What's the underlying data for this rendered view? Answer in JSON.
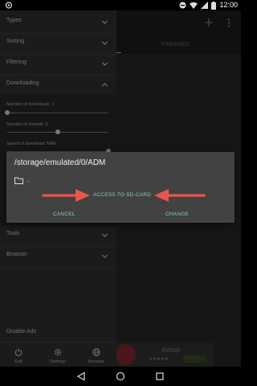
{
  "status_bar": {
    "time": "12:00"
  },
  "main": {
    "finished_tab_label": "FINISHED"
  },
  "ad": {
    "title": "Airbnb",
    "stars": "★★★★★",
    "badge": "INSTALL"
  },
  "drawer": {
    "sections": [
      {
        "label": "Types",
        "chevron": "chevron-down-icon"
      },
      {
        "label": "Sorting",
        "chevron": "chevron-down-icon"
      },
      {
        "label": "Filtering",
        "chevron": "chevron-down-icon"
      },
      {
        "label": "Downloading",
        "chevron": "chevron-up-icon"
      }
    ],
    "sliders": [
      {
        "label": "Number of downloads: 1",
        "value_fraction": 0.0
      },
      {
        "label": "Number of threads: 5",
        "value_fraction": 0.5
      },
      {
        "label": "Speed of download: MAX",
        "value_fraction": 1.0
      }
    ],
    "tools_label": "Tools",
    "browser_section_label": "Browser",
    "disable_ads_label": "Disable Ads",
    "bottom_items": [
      {
        "label": "Exit",
        "icon": "power-icon"
      },
      {
        "label": "Settings",
        "icon": "gear-icon"
      },
      {
        "label": "Browser",
        "icon": "globe-icon"
      }
    ]
  },
  "dialog": {
    "path": "/storage/emulated/0/ADM",
    "parent_folder": "..",
    "access_button": "ACCESS TO SD-CARD",
    "cancel_button": "CANCEL",
    "change_button": "CHANGE",
    "accent_color": "#7fd1be",
    "arrow_color": "#e8574b"
  }
}
